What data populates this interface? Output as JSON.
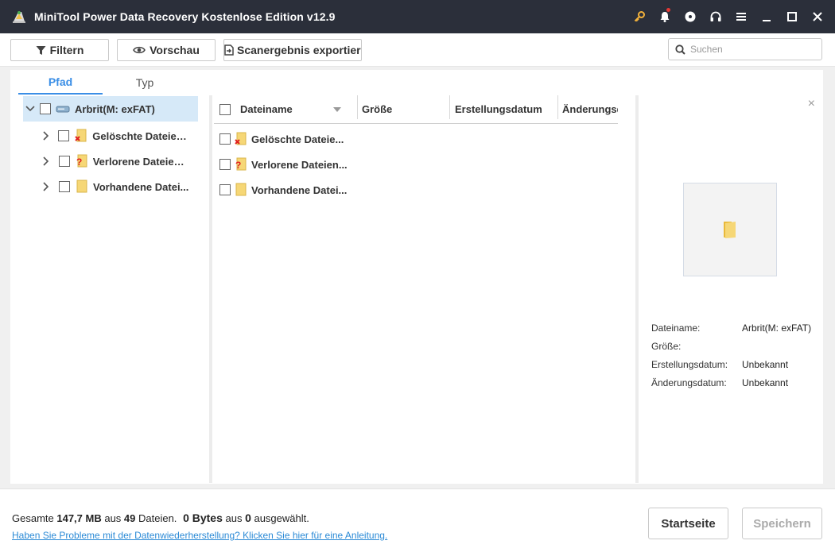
{
  "window": {
    "title": "MiniTool Power Data Recovery Kostenlose Edition v12.9",
    "icons": [
      "key-icon",
      "bell-icon",
      "disc-icon",
      "headphones-icon",
      "menu-icon",
      "minimize-icon",
      "maximize-icon",
      "close-icon"
    ]
  },
  "toolbar": {
    "filter_label": "Filtern",
    "preview_label": "Vorschau",
    "export_label": "Scanergebnis exportieren",
    "search_placeholder": "Suchen"
  },
  "tabs": [
    {
      "label": "Pfad",
      "active": true
    },
    {
      "label": "Typ",
      "active": false
    }
  ],
  "tree": {
    "root": {
      "label": "Arbrit(M: exFAT)",
      "expanded": true,
      "selected": true
    },
    "children": [
      {
        "label": "Gelöschte Dateien ...",
        "icon": "deleted-folder-icon"
      },
      {
        "label": "Verlorene Dateien ...",
        "icon": "lost-folder-icon"
      },
      {
        "label": "Vorhandene Datei...",
        "icon": "folder-icon"
      }
    ]
  },
  "file_list": {
    "columns": [
      "Dateiname",
      "Größe",
      "Erstellungsdatum",
      "Änderungsd"
    ],
    "rows": [
      {
        "name": "Gelöschte Dateie...",
        "icon": "deleted-folder-icon"
      },
      {
        "name": "Verlorene Dateien...",
        "icon": "lost-folder-icon"
      },
      {
        "name": "Vorhandene Datei...",
        "icon": "folder-icon"
      }
    ]
  },
  "preview": {
    "close": "×",
    "properties": [
      {
        "label": "Dateiname:",
        "value": "Arbrit(M: exFAT)"
      },
      {
        "label": "Größe:",
        "value": ""
      },
      {
        "label": "Erstellungsdatum:",
        "value": "Unbekannt"
      },
      {
        "label": "Änderungsdatum:",
        "value": "Unbekannt"
      }
    ]
  },
  "footer": {
    "total_prefix": "Gesamte ",
    "total_size": "147,7 MB",
    "total_mid": " aus ",
    "total_count": "49",
    "total_suffix": " Dateien.",
    "selected_size": "0 Bytes",
    "selected_mid": " aus ",
    "selected_count": "0",
    "selected_suffix": " ausgewählt.",
    "help_link": "Haben Sie Probleme mit der Datenwiederherstellung? Klicken Sie hier für eine Anleitung.",
    "home_button": "Startseite",
    "save_button": "Speichern"
  },
  "colors": {
    "titlebar": "#2b2f3a",
    "accent": "#3a8ee6",
    "selected_row": "#d6e9f8",
    "folder": "#f6d776",
    "deleted_mark": "#e02020"
  }
}
